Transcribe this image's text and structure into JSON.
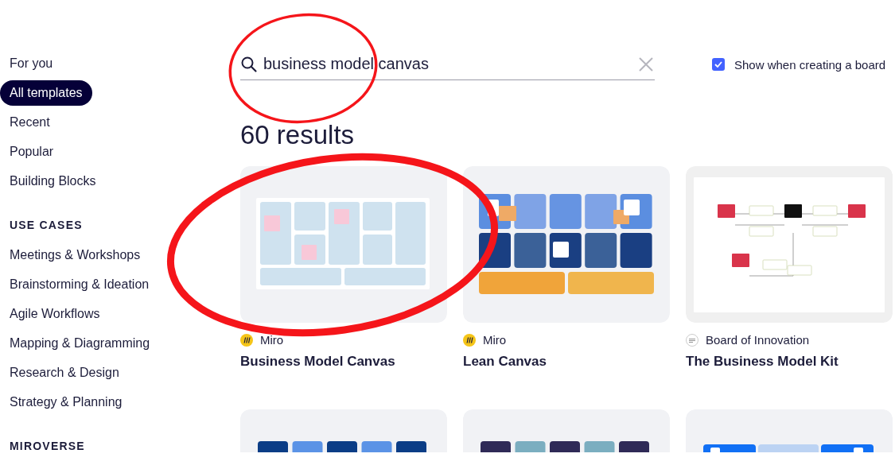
{
  "sidebar": {
    "items": [
      {
        "label": "For you",
        "selected": false
      },
      {
        "label": "All templates",
        "selected": true
      },
      {
        "label": "Recent",
        "selected": false
      },
      {
        "label": "Popular",
        "selected": false
      },
      {
        "label": "Building Blocks",
        "selected": false
      }
    ],
    "sections": [
      {
        "heading": "USE CASES",
        "items": [
          {
            "label": "Meetings & Workshops",
            "selected": false
          },
          {
            "label": "Brainstorming & Ideation",
            "selected": false
          },
          {
            "label": "Agile Workflows",
            "selected": false
          },
          {
            "label": "Mapping & Diagramming",
            "selected": false
          },
          {
            "label": "Research & Design",
            "selected": false
          },
          {
            "label": "Strategy & Planning",
            "selected": false
          }
        ]
      },
      {
        "heading": "MIROVERSE"
      }
    ]
  },
  "search": {
    "value": "business model canvas"
  },
  "show_option": {
    "label": "Show when creating a board",
    "checked": true
  },
  "results_count": "60 results",
  "cards": [
    {
      "kind": "bmc",
      "author": {
        "kind": "miro",
        "name": "Miro"
      },
      "title": "Business Model Canvas"
    },
    {
      "kind": "lean",
      "author": {
        "kind": "miro",
        "name": "Miro"
      },
      "title": "Lean Canvas"
    },
    {
      "kind": "kit",
      "author": {
        "kind": "boi",
        "name": "Board of Innovation"
      },
      "title": "The Business Model Kit"
    }
  ],
  "more_cards": [
    {
      "kind": "blue-blocks"
    },
    {
      "kind": "slate-blocks"
    },
    {
      "kind": "bright-blocks"
    }
  ],
  "annotations": [
    {
      "kind": "circle"
    },
    {
      "kind": "circle"
    }
  ]
}
